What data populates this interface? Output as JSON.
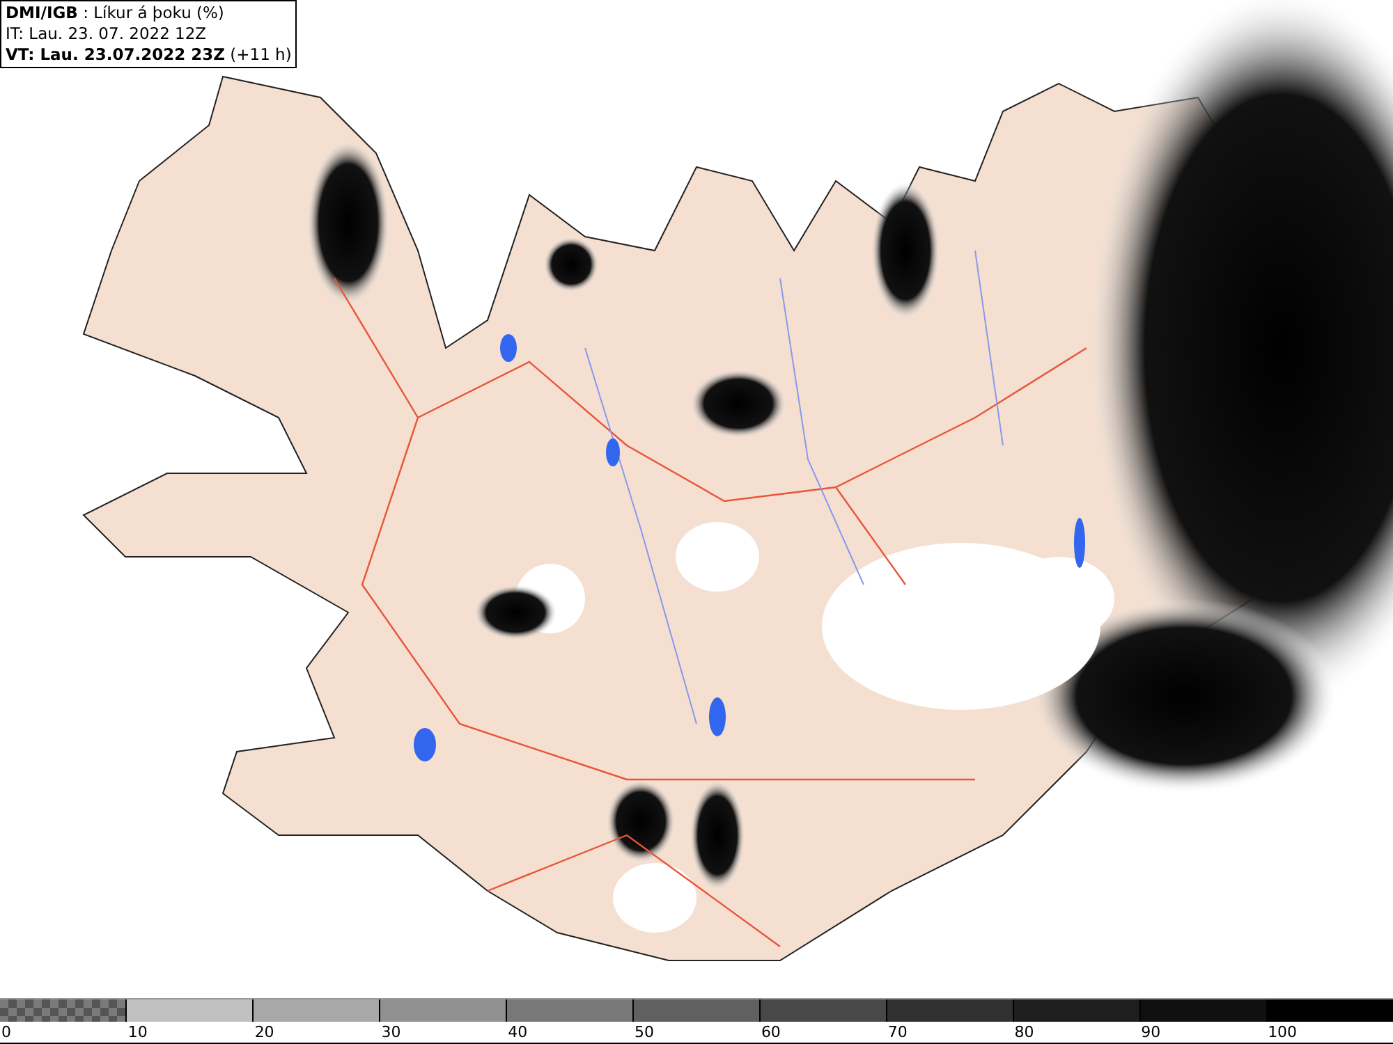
{
  "header": {
    "lines": [
      "**DMI/IGB** : Líkur á þoku (%)",
      "IT: Lau. 23. 07. 2022 12Z",
      "**VT: Lau. 23.07.2022 23Z** (+11 h)"
    ]
  },
  "legend": {
    "segments": [
      {
        "kind": "checker",
        "color": "#7a7a7a"
      },
      {
        "kind": "solid",
        "color": "#c0c0c0"
      },
      {
        "kind": "solid",
        "color": "#a8a8a8"
      },
      {
        "kind": "solid",
        "color": "#909090"
      },
      {
        "kind": "solid",
        "color": "#787878"
      },
      {
        "kind": "solid",
        "color": "#606060"
      },
      {
        "kind": "solid",
        "color": "#484848"
      },
      {
        "kind": "solid",
        "color": "#303030"
      },
      {
        "kind": "solid",
        "color": "#1e1e1e"
      },
      {
        "kind": "solid",
        "color": "#101010"
      },
      {
        "kind": "solid",
        "color": "#000000"
      }
    ],
    "ticks": [
      "0",
      "10",
      "20",
      "30",
      "40",
      "50",
      "60",
      "70",
      "80",
      "90",
      "100"
    ]
  }
}
